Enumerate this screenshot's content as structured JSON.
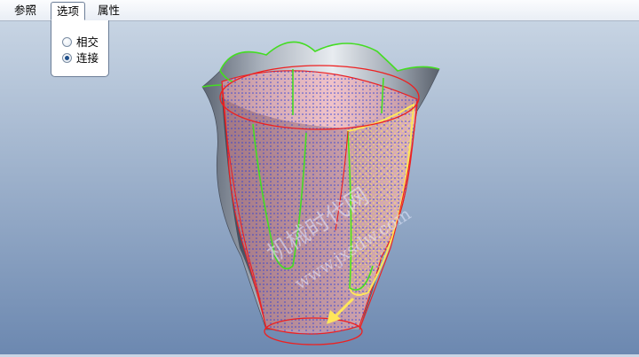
{
  "tabs": [
    {
      "label": "参照"
    },
    {
      "label": "选项"
    },
    {
      "label": "属性"
    }
  ],
  "options_panel": {
    "radios": [
      {
        "label": "相交",
        "checked": false
      },
      {
        "label": "连接",
        "checked": true
      }
    ]
  },
  "watermark": {
    "line1": "机械时代网",
    "line2": "www.jxsdw.com"
  },
  "colors": {
    "background_top": "#c7d4e3",
    "background_bottom": "#6c88b0",
    "surface_gray": "#9aa2ad",
    "edge_red": "#ee2020",
    "edge_green": "#44dd22",
    "mesh_blue": "#2a3fd8",
    "selected_yellow": "#ffe65a"
  }
}
